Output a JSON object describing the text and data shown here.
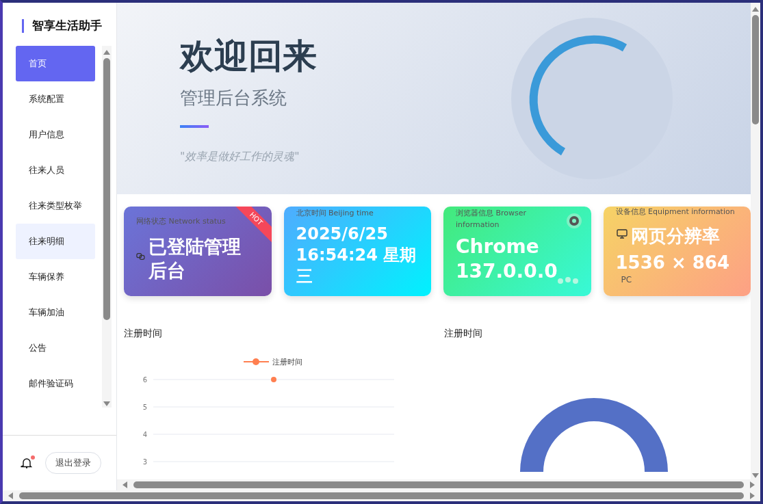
{
  "sidebar": {
    "title": "智享生活助手",
    "items": [
      {
        "label": "首页",
        "selected": true,
        "highlighted": false
      },
      {
        "label": "系统配置",
        "selected": false,
        "highlighted": false
      },
      {
        "label": "用户信息",
        "selected": false,
        "highlighted": false
      },
      {
        "label": "往来人员",
        "selected": false,
        "highlighted": false
      },
      {
        "label": "往来类型枚举",
        "selected": false,
        "highlighted": false
      },
      {
        "label": "往来明细",
        "selected": false,
        "highlighted": true
      },
      {
        "label": "车辆保养",
        "selected": false,
        "highlighted": false
      },
      {
        "label": "车辆加油",
        "selected": false,
        "highlighted": false
      },
      {
        "label": "公告",
        "selected": false,
        "highlighted": false
      },
      {
        "label": "邮件验证码",
        "selected": false,
        "highlighted": false
      }
    ],
    "notification": {
      "unread": true
    },
    "logout": "退出登录"
  },
  "banner": {
    "title": "欢迎回来",
    "subtitle": "管理后台系统",
    "quote": "\"效率是做好工作的灵魂\""
  },
  "cards": [
    {
      "kind": "network",
      "label": "网络状态 Network status",
      "value": "已登陆管理后台",
      "badge": "HOT"
    },
    {
      "kind": "time",
      "label": "北京时间 Beijing time",
      "value": "2025/6/25 16:54:24 星期三"
    },
    {
      "kind": "browser",
      "label": "浏览器信息 Browser information",
      "value": "Chrome 137.0.0.0"
    },
    {
      "kind": "device",
      "label": "设备信息 Equipment information",
      "value": "网页分辨率",
      "detail": "1536 × 864",
      "footer": "PC"
    }
  ],
  "charts": [
    {
      "kind": "line",
      "title": "注册时间",
      "chart_data": {
        "type": "line",
        "series": [
          {
            "name": "注册时间",
            "color": "#ff7f50",
            "values": [
              6
            ],
            "marker": "circle"
          }
        ],
        "ylim": [
          3,
          6
        ],
        "yticks": [
          3,
          4,
          5,
          6
        ]
      }
    },
    {
      "kind": "donut",
      "title": "注册时间"
    }
  ]
}
